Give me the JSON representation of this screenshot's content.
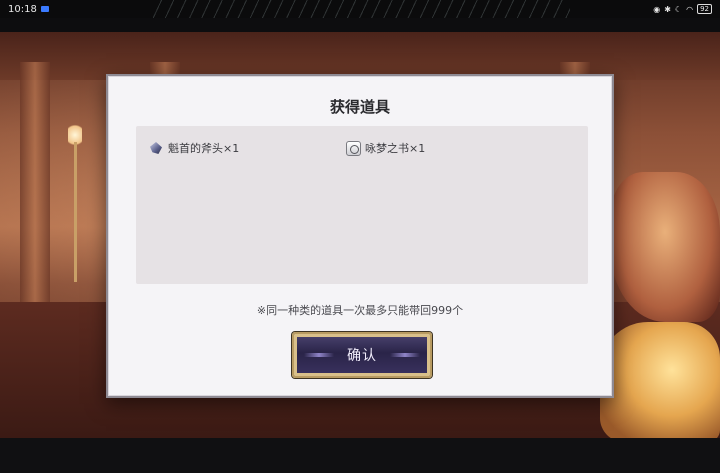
{
  "status_bar": {
    "time": "10:18",
    "battery": "92",
    "icons": [
      "app-notification-icon",
      "eye-icon",
      "bluetooth-icon",
      "moon-icon",
      "wifi-icon",
      "battery-icon"
    ]
  },
  "dialog": {
    "title": "获得道具",
    "items": [
      {
        "name": "魁首的斧头×1",
        "icon": "axe-crystal-icon"
      },
      {
        "name": "咏梦之书×1",
        "icon": "book-icon"
      }
    ],
    "notice": "※同一种类的道具一次最多只能带回999个",
    "confirm_label": "确认"
  },
  "colors": {
    "dialog_bg": "#f5f4f7",
    "panel_bg": "#e6e2e5",
    "button_bg": "#2a2448",
    "button_border": "#b89b62"
  }
}
